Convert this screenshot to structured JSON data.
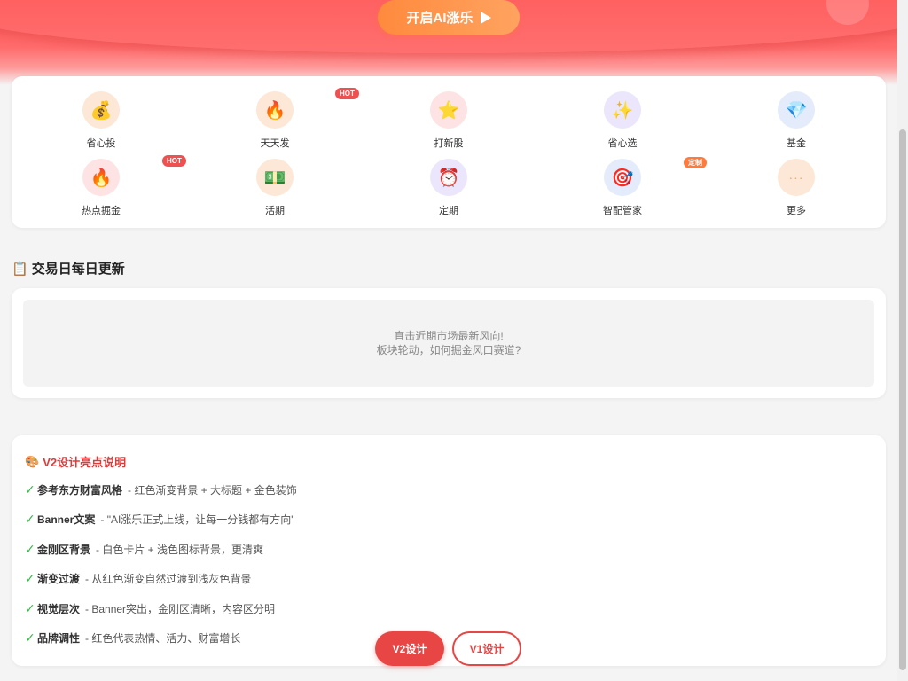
{
  "hero": {
    "start_label": "开启AI涨乐"
  },
  "kingkong": [
    {
      "label": "省心投",
      "icon": "money-bag-icon",
      "glyph": "💰",
      "bg": "#fde7d6"
    },
    {
      "label": "天天发",
      "icon": "fire-icon",
      "glyph": "🔥",
      "bg": "#fde7d6",
      "badge": "HOT"
    },
    {
      "label": "打新股",
      "icon": "star-icon",
      "glyph": "⭐",
      "bg": "#fde3e3"
    },
    {
      "label": "省心选",
      "icon": "sparkles-icon",
      "glyph": "✨",
      "bg": "#ebe6fb"
    },
    {
      "label": "基金",
      "icon": "diamond-icon",
      "glyph": "💎",
      "bg": "#e4ebfb"
    },
    {
      "label": "热点掘金",
      "icon": "fire-icon",
      "glyph": "🔥",
      "bg": "#fde3e3",
      "badge": "HOT"
    },
    {
      "label": "活期",
      "icon": "cash-icon",
      "glyph": "💵",
      "bg": "#fde7d6"
    },
    {
      "label": "定期",
      "icon": "alarm-clock-icon",
      "glyph": "⏰",
      "bg": "#ebe6fb"
    },
    {
      "label": "智配管家",
      "icon": "target-icon",
      "glyph": "🎯",
      "bg": "#e4ebfb",
      "badge": "定制"
    },
    {
      "label": "更多",
      "icon": "more-dots-icon",
      "glyph": "···",
      "bg": "#fde7d6"
    }
  ],
  "daily": {
    "title": "交易日每日更新",
    "icon": "clipboard-icon",
    "line1": "直击近期市场最新风向!",
    "line2": "板块轮动，如何掘金风口赛道?"
  },
  "notes": {
    "title": "V2设计亮点说明",
    "icon": "palette-icon",
    "items": [
      {
        "key": "参考东方财富风格",
        "desc": "- 红色渐变背景 + 大标题 + 金色装饰"
      },
      {
        "key": "Banner文案",
        "desc": "- \"AI涨乐正式上线，让每一分钱都有方向\""
      },
      {
        "key": "金刚区背景",
        "desc": "- 白色卡片 + 浅色图标背景，更清爽"
      },
      {
        "key": "渐变过渡",
        "desc": "- 从红色渐变自然过渡到浅灰色背景"
      },
      {
        "key": "视觉层次",
        "desc": "- Banner突出，金刚区清晰，内容区分明"
      },
      {
        "key": "品牌调性",
        "desc": "- 红色代表热情、活力、财富增长"
      }
    ]
  },
  "switch": {
    "v2_label": "V2设计",
    "v1_label": "V1设计"
  },
  "colors": {
    "brand_red": "#e84545",
    "accent_orange": "#ff8a3d",
    "check_green": "#39b54a"
  }
}
